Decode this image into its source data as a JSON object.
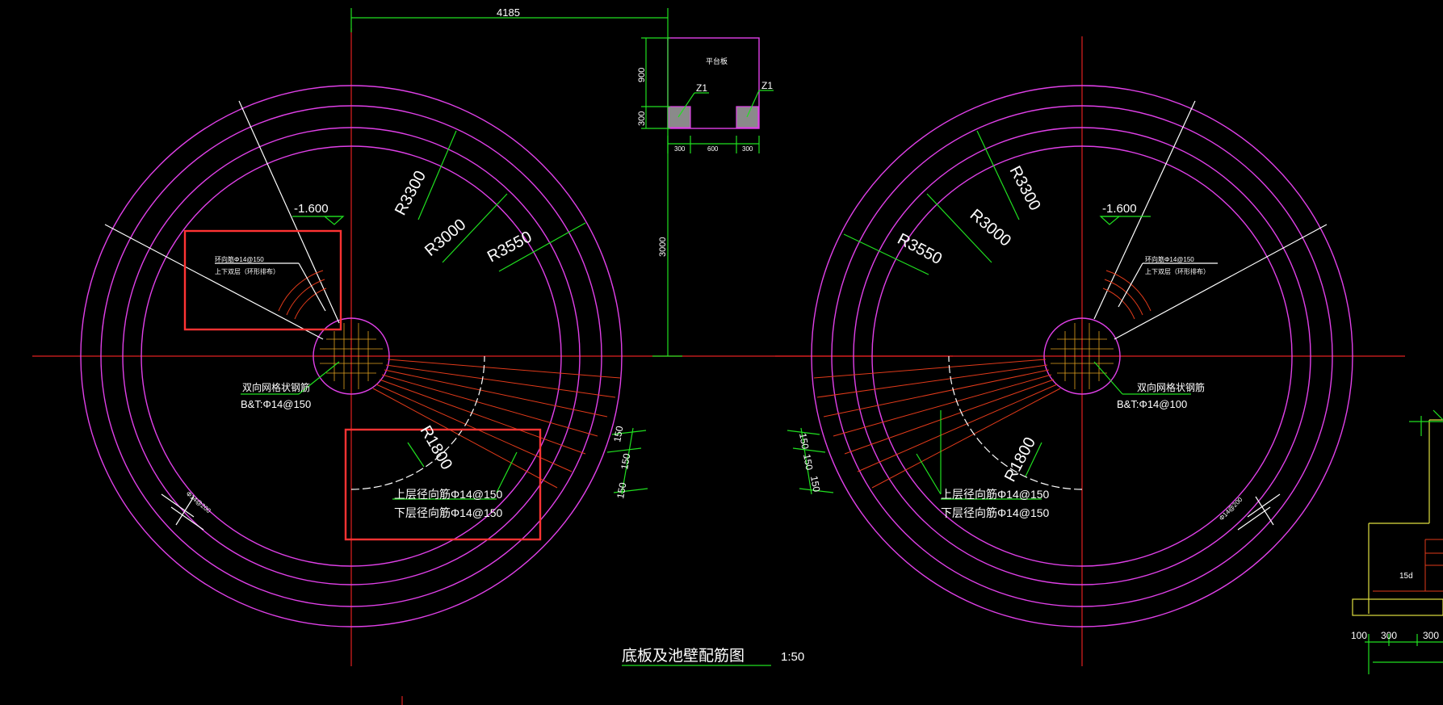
{
  "drawing": {
    "title": "底板及池壁配筋图",
    "scale": "1:50",
    "top_dim": "4185",
    "platform": {
      "label": "平台板",
      "col_left": "Z1",
      "col_right": "Z1",
      "dim_900": "900",
      "dim_300": "300",
      "dim_3000": "3000",
      "bottom_left": "300",
      "bottom_mid": "600",
      "bottom_right": "300"
    },
    "left_plan": {
      "r_inner": "R3300",
      "r_mid": "R3000",
      "r_outer": "R3550",
      "r_small": "R1800",
      "elevation": "-1.600",
      "ring_note_1": "环向筋Φ14@150",
      "ring_note_2": "上下双层（环形排布）",
      "mesh_label": "双向网格状钢筋",
      "mesh_spec": "B&T:Φ14@150",
      "radial_top": "上层径向筋Φ14@150",
      "radial_bottom": "下层径向筋Φ14@150",
      "spacing_1": "150",
      "spacing_2": "150",
      "spacing_3": "150",
      "wall_bar": "Φ14@200"
    },
    "right_plan": {
      "r_inner": "R3300",
      "r_mid": "R3000",
      "r_outer": "R3550",
      "r_small": "R1800",
      "elevation": "-1.600",
      "ring_note_1": "环向筋Φ14@150",
      "ring_note_2": "上下双层（环形排布）",
      "mesh_label": "双向网格状钢筋",
      "mesh_spec": "B&T:Φ14@100",
      "radial_top": "上层径向筋Φ14@150",
      "radial_bottom": "下层径向筋Φ14@150",
      "spacing_1": "150",
      "spacing_2": "150",
      "spacing_3": "150",
      "wall_bar": "Φ14@200"
    },
    "section": {
      "anchor": "15d",
      "dim_a": "100",
      "dim_b": "300",
      "dim_c": "300"
    },
    "colors": {
      "wall": "#e040e8",
      "centerline": "#e02020",
      "dimension": "#20e020",
      "highlight": "#ff3333",
      "rebar": "#e03a1a"
    }
  }
}
